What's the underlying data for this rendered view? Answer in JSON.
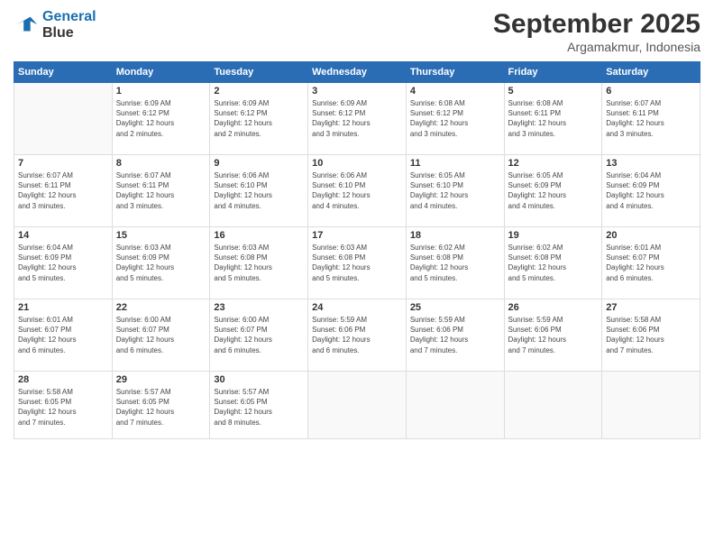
{
  "logo": {
    "line1": "General",
    "line2": "Blue"
  },
  "title": "September 2025",
  "subtitle": "Argamakmur, Indonesia",
  "days_header": [
    "Sunday",
    "Monday",
    "Tuesday",
    "Wednesday",
    "Thursday",
    "Friday",
    "Saturday"
  ],
  "weeks": [
    [
      {
        "day": "",
        "info": ""
      },
      {
        "day": "1",
        "info": "Sunrise: 6:09 AM\nSunset: 6:12 PM\nDaylight: 12 hours\nand 2 minutes."
      },
      {
        "day": "2",
        "info": "Sunrise: 6:09 AM\nSunset: 6:12 PM\nDaylight: 12 hours\nand 2 minutes."
      },
      {
        "day": "3",
        "info": "Sunrise: 6:09 AM\nSunset: 6:12 PM\nDaylight: 12 hours\nand 3 minutes."
      },
      {
        "day": "4",
        "info": "Sunrise: 6:08 AM\nSunset: 6:12 PM\nDaylight: 12 hours\nand 3 minutes."
      },
      {
        "day": "5",
        "info": "Sunrise: 6:08 AM\nSunset: 6:11 PM\nDaylight: 12 hours\nand 3 minutes."
      },
      {
        "day": "6",
        "info": "Sunrise: 6:07 AM\nSunset: 6:11 PM\nDaylight: 12 hours\nand 3 minutes."
      }
    ],
    [
      {
        "day": "7",
        "info": "Sunrise: 6:07 AM\nSunset: 6:11 PM\nDaylight: 12 hours\nand 3 minutes."
      },
      {
        "day": "8",
        "info": "Sunrise: 6:07 AM\nSunset: 6:11 PM\nDaylight: 12 hours\nand 3 minutes."
      },
      {
        "day": "9",
        "info": "Sunrise: 6:06 AM\nSunset: 6:10 PM\nDaylight: 12 hours\nand 4 minutes."
      },
      {
        "day": "10",
        "info": "Sunrise: 6:06 AM\nSunset: 6:10 PM\nDaylight: 12 hours\nand 4 minutes."
      },
      {
        "day": "11",
        "info": "Sunrise: 6:05 AM\nSunset: 6:10 PM\nDaylight: 12 hours\nand 4 minutes."
      },
      {
        "day": "12",
        "info": "Sunrise: 6:05 AM\nSunset: 6:09 PM\nDaylight: 12 hours\nand 4 minutes."
      },
      {
        "day": "13",
        "info": "Sunrise: 6:04 AM\nSunset: 6:09 PM\nDaylight: 12 hours\nand 4 minutes."
      }
    ],
    [
      {
        "day": "14",
        "info": "Sunrise: 6:04 AM\nSunset: 6:09 PM\nDaylight: 12 hours\nand 5 minutes."
      },
      {
        "day": "15",
        "info": "Sunrise: 6:03 AM\nSunset: 6:09 PM\nDaylight: 12 hours\nand 5 minutes."
      },
      {
        "day": "16",
        "info": "Sunrise: 6:03 AM\nSunset: 6:08 PM\nDaylight: 12 hours\nand 5 minutes."
      },
      {
        "day": "17",
        "info": "Sunrise: 6:03 AM\nSunset: 6:08 PM\nDaylight: 12 hours\nand 5 minutes."
      },
      {
        "day": "18",
        "info": "Sunrise: 6:02 AM\nSunset: 6:08 PM\nDaylight: 12 hours\nand 5 minutes."
      },
      {
        "day": "19",
        "info": "Sunrise: 6:02 AM\nSunset: 6:08 PM\nDaylight: 12 hours\nand 5 minutes."
      },
      {
        "day": "20",
        "info": "Sunrise: 6:01 AM\nSunset: 6:07 PM\nDaylight: 12 hours\nand 6 minutes."
      }
    ],
    [
      {
        "day": "21",
        "info": "Sunrise: 6:01 AM\nSunset: 6:07 PM\nDaylight: 12 hours\nand 6 minutes."
      },
      {
        "day": "22",
        "info": "Sunrise: 6:00 AM\nSunset: 6:07 PM\nDaylight: 12 hours\nand 6 minutes."
      },
      {
        "day": "23",
        "info": "Sunrise: 6:00 AM\nSunset: 6:07 PM\nDaylight: 12 hours\nand 6 minutes."
      },
      {
        "day": "24",
        "info": "Sunrise: 5:59 AM\nSunset: 6:06 PM\nDaylight: 12 hours\nand 6 minutes."
      },
      {
        "day": "25",
        "info": "Sunrise: 5:59 AM\nSunset: 6:06 PM\nDaylight: 12 hours\nand 7 minutes."
      },
      {
        "day": "26",
        "info": "Sunrise: 5:59 AM\nSunset: 6:06 PM\nDaylight: 12 hours\nand 7 minutes."
      },
      {
        "day": "27",
        "info": "Sunrise: 5:58 AM\nSunset: 6:06 PM\nDaylight: 12 hours\nand 7 minutes."
      }
    ],
    [
      {
        "day": "28",
        "info": "Sunrise: 5:58 AM\nSunset: 6:05 PM\nDaylight: 12 hours\nand 7 minutes."
      },
      {
        "day": "29",
        "info": "Sunrise: 5:57 AM\nSunset: 6:05 PM\nDaylight: 12 hours\nand 7 minutes."
      },
      {
        "day": "30",
        "info": "Sunrise: 5:57 AM\nSunset: 6:05 PM\nDaylight: 12 hours\nand 8 minutes."
      },
      {
        "day": "",
        "info": ""
      },
      {
        "day": "",
        "info": ""
      },
      {
        "day": "",
        "info": ""
      },
      {
        "day": "",
        "info": ""
      }
    ]
  ]
}
